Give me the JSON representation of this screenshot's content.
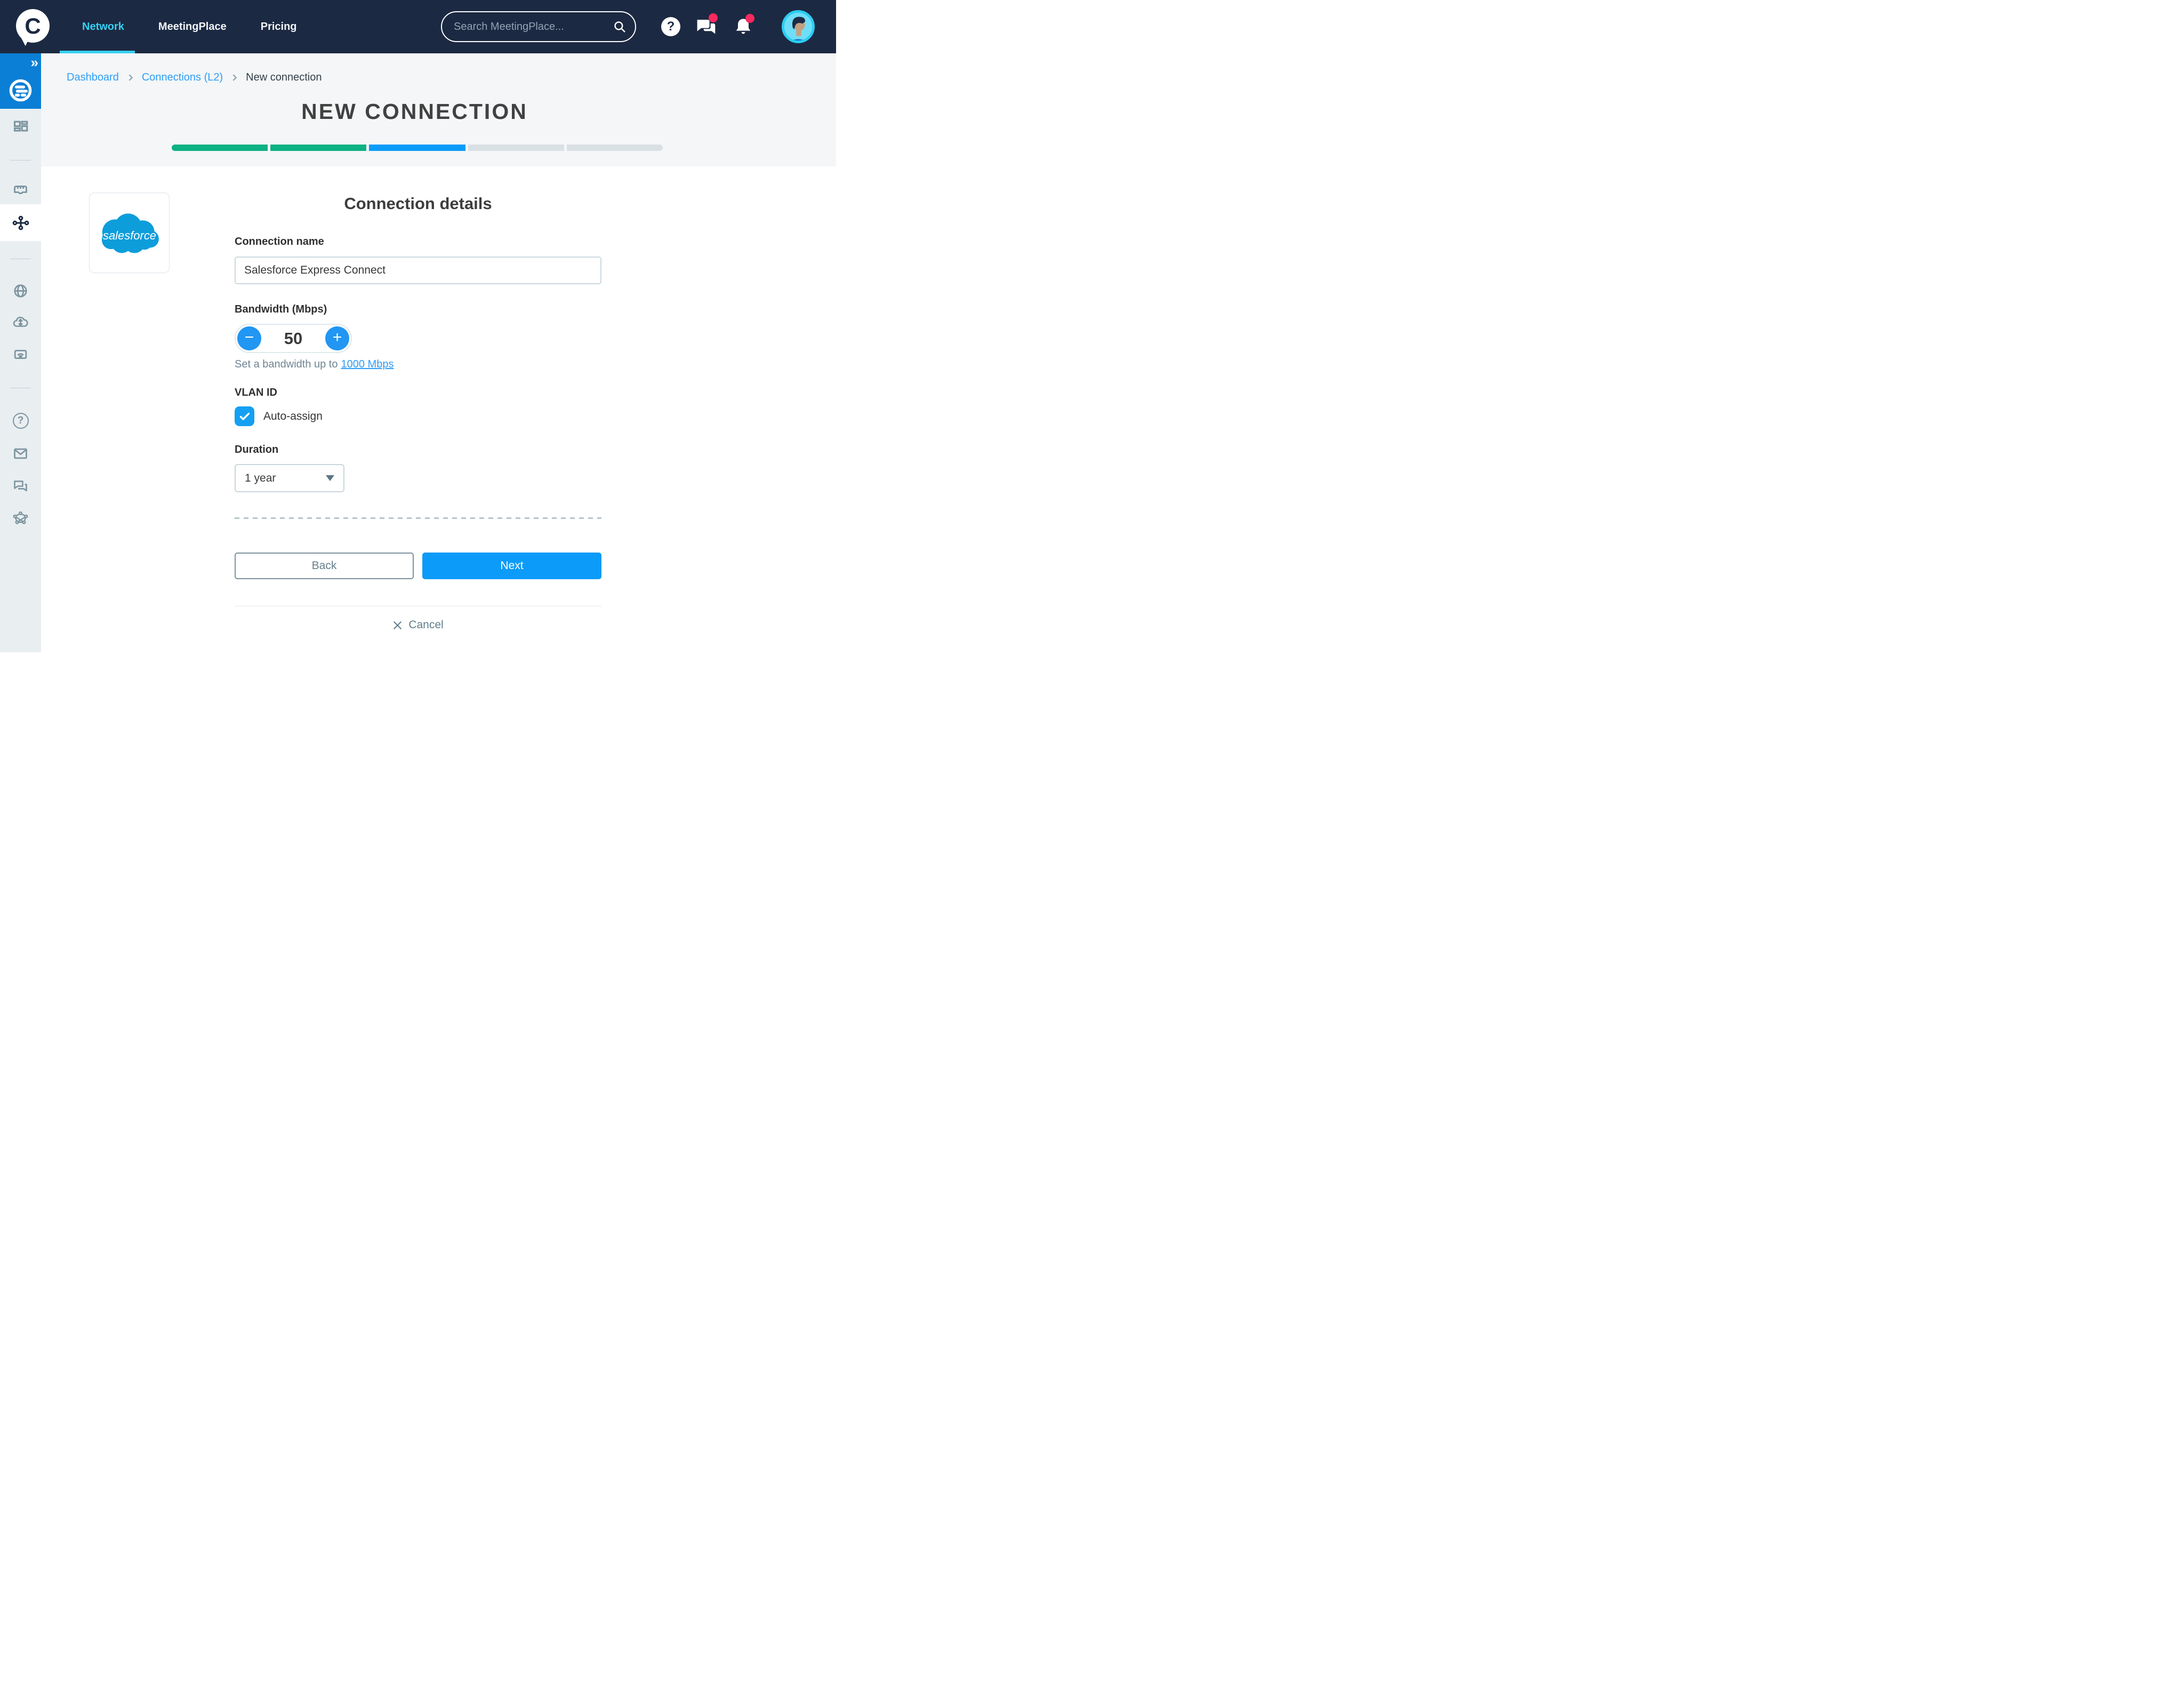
{
  "navbar": {
    "logo_glyph": "C",
    "items": [
      {
        "label": "Network",
        "active": true
      },
      {
        "label": "MeetingPlace",
        "active": false
      },
      {
        "label": "Pricing",
        "active": false
      }
    ],
    "search": {
      "placeholder": "Search MeetingPlace..."
    },
    "help_glyph": "?"
  },
  "sidebar": {
    "expand_glyph": "»",
    "help_glyph": "?",
    "icons": [
      "dashboard-grid",
      "port",
      "connections-network",
      "globe",
      "cloud-exchange",
      "router-wifi",
      "help",
      "mail",
      "chat",
      "mesh-network"
    ]
  },
  "breadcrumb": {
    "items": [
      {
        "label": "Dashboard",
        "type": "link"
      },
      {
        "label": "Connections (L2)",
        "type": "link"
      },
      {
        "label": "New connection",
        "type": "current"
      }
    ]
  },
  "page": {
    "title": "NEW CONNECTION"
  },
  "progress": {
    "segments": [
      {
        "state": "complete"
      },
      {
        "state": "complete"
      },
      {
        "state": "current"
      },
      {
        "state": "upcoming"
      },
      {
        "state": "upcoming"
      }
    ]
  },
  "provider": {
    "name": "salesforce"
  },
  "form": {
    "heading": "Connection details",
    "connection_name": {
      "label": "Connection name",
      "value": "Salesforce Express Connect"
    },
    "bandwidth": {
      "label": "Bandwidth (Mbps)",
      "value": "50",
      "minus_glyph": "−",
      "plus_glyph": "+",
      "helper_prefix": "Set a bandwidth up to",
      "helper_link": "1000 Mbps"
    },
    "vlan": {
      "label": "VLAN ID",
      "checkbox_label": "Auto-assign",
      "checked": true
    },
    "duration": {
      "label": "Duration",
      "value": "1 year"
    },
    "actions": {
      "back": "Back",
      "next": "Next",
      "cancel": "Cancel"
    }
  },
  "colors": {
    "accent_blue": "#0c9bf8",
    "green": "#0db183",
    "cyan": "#36d0f2",
    "badge_pink": "#f9295e",
    "navy": "#1c2942",
    "sidebar_blue": "#0b7fd6",
    "salesforce_blue": "#0d9ddb"
  }
}
